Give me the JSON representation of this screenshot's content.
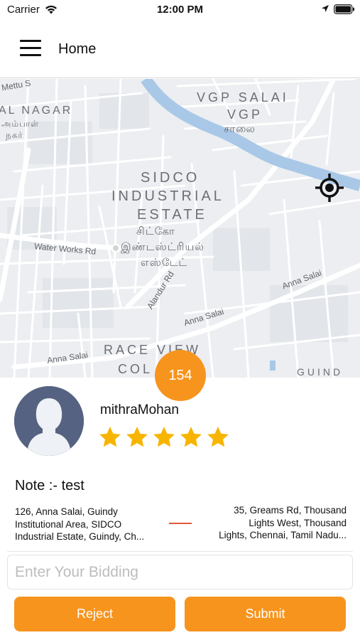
{
  "status_bar": {
    "carrier": "Carrier",
    "time": "12:00 PM",
    "icons": [
      "wifi-icon",
      "location-arrow-icon",
      "battery-icon"
    ]
  },
  "nav": {
    "title": "Home",
    "menu_icon": "hamburger-menu-icon"
  },
  "map": {
    "labels": {
      "nagar": "AL NAGAR",
      "nagar_ta1": "அம்பாள்",
      "nagar_ta2": "நகர்",
      "vgp_salai": "VGP SALAI",
      "vgp": "VGP",
      "vgp_ta": "சாலை",
      "sidco1": "SIDCO",
      "sidco2": "INDUSTRIAL",
      "sidco3": "ESTATE",
      "sidco_ta1": "சிட்கோ",
      "sidco_ta2": "இண்டஸ்ட்ரியல்",
      "sidco_ta3": "எஸ்டேட்",
      "water_works": "Water Works Rd",
      "alandur": "Alandur Rd",
      "anna_salai_1": "Anna Salai",
      "anna_salai_2": "Anna Salai",
      "anna_salai_3": "Anna Salai",
      "race_view": "RACE VIEW",
      "col": "COL",
      "guindy": "GUIND",
      "mettu": "Mettu S"
    },
    "locate_icon": "gps-target-icon"
  },
  "price_badge": "154",
  "user": {
    "name": "mithraMohan",
    "rating": 5,
    "rating_max": 5,
    "avatar_icon": "default-avatar-icon"
  },
  "note": "Note :- test",
  "pickup": {
    "lines": [
      "126, Anna Salai, Guindy",
      "Institutional Area, SIDCO",
      "Industrial Estate, Guindy, Ch..."
    ]
  },
  "drop": {
    "lines": [
      "35, Greams Rd, Thousand",
      "Lights West, Thousand",
      "Lights, Chennai, Tamil Nadu..."
    ]
  },
  "bid": {
    "placeholder": "Enter Your Bidding",
    "value": ""
  },
  "actions": {
    "reject": "Reject",
    "submit": "Submit"
  },
  "colors": {
    "accent": "#f7941d",
    "route_line": "#e05a3a",
    "avatar_bg": "#566281",
    "star": "#f7b500",
    "river": "#a9c8e8"
  }
}
